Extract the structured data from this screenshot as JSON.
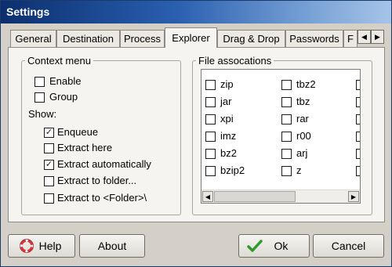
{
  "window": {
    "title": "Settings"
  },
  "tabs": [
    "General",
    "Destination",
    "Process",
    "Explorer",
    "Drag & Drop",
    "Passwords",
    "F"
  ],
  "active_tab": "Explorer",
  "context_menu": {
    "legend": "Context menu",
    "enable": {
      "label": "Enable",
      "checked": false
    },
    "group": {
      "label": "Group",
      "checked": false
    },
    "show_label": "Show:",
    "show_items": [
      {
        "label": "Enqueue",
        "checked": true
      },
      {
        "label": "Extract here",
        "checked": false
      },
      {
        "label": "Extract automatically",
        "checked": true
      },
      {
        "label": "Extract to folder...",
        "checked": false
      },
      {
        "label": "Extract to <Folder>\\",
        "checked": false
      }
    ]
  },
  "file_associations": {
    "legend": "File assocations",
    "columns": [
      [
        "zip",
        "jar",
        "xpi",
        "imz",
        "bz2",
        "bzip2"
      ],
      [
        "tbz2",
        "tbz",
        "rar",
        "r00",
        "arj",
        "z"
      ]
    ]
  },
  "buttons": {
    "help": "Help",
    "about": "About",
    "ok": "Ok",
    "cancel": "Cancel"
  }
}
